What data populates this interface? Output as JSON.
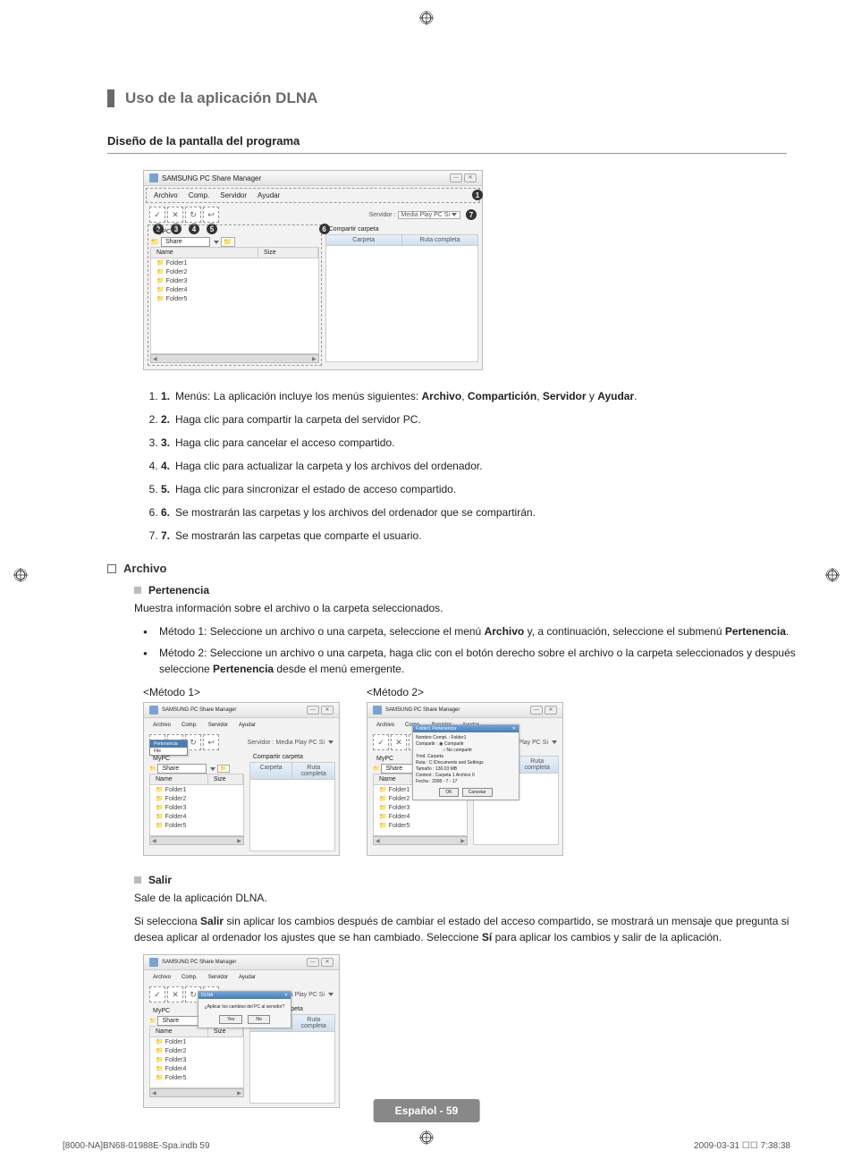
{
  "header": {
    "title": "Uso de la aplicación DLNA"
  },
  "section": {
    "subtitle": "Diseño de la pantalla del programa"
  },
  "app": {
    "title": "SAMSUNG PC Share Manager",
    "menus": [
      "Archivo",
      "Comp.",
      "Servidor",
      "Ayudar"
    ],
    "server_label": "Servidor :",
    "server_value": "Media Play PC Si",
    "mypc": "MyPC",
    "share_label": "Share",
    "compartir_carpeta": "Compartir carpeta",
    "columns": {
      "name": "Name",
      "size": "Size"
    },
    "right_columns": {
      "carpeta": "Carpeta",
      "ruta": "Ruta completa"
    },
    "folders": [
      "Folder1",
      "Folder2",
      "Folder3",
      "Folder4",
      "Folder5"
    ]
  },
  "steps": [
    {
      "n": "1.",
      "prefix": "Menús: La aplicación incluye los menús siguientes: ",
      "bold_list": [
        "Archivo",
        "Compartición",
        "Servidor",
        "Ayudar"
      ],
      "joiners": [
        ", ",
        ", ",
        " y ",
        "."
      ]
    },
    {
      "n": "2.",
      "text": "Haga clic para compartir la carpeta del servidor PC."
    },
    {
      "n": "3.",
      "text": "Haga clic para cancelar el acceso compartido."
    },
    {
      "n": "4.",
      "text": "Haga clic para actualizar la carpeta y los archivos del ordenador."
    },
    {
      "n": "5.",
      "text": "Haga clic para sincronizar el estado de acceso compartido."
    },
    {
      "n": "6.",
      "text": "Se mostrarán las carpetas y los archivos del ordenador que se compartirán."
    },
    {
      "n": "7.",
      "text": "Se mostrarán las carpetas que comparte el usuario."
    }
  ],
  "archivo": {
    "title": "Archivo",
    "pertenencia": {
      "title": "Pertenencia",
      "desc": "Muestra información sobre el archivo o la carpeta seleccionados.",
      "m1_pre": "Método 1: Seleccione un archivo o una carpeta, seleccione el menú ",
      "m1_bold1": "Archivo",
      "m1_mid": " y, a continuación, seleccione el submenú ",
      "m1_bold2": "Pertenencia",
      "m1_post": ".",
      "m2_pre": "Método 2: Seleccione un archivo o una carpeta, haga clic con el botón derecho sobre el archivo o la carpeta seleccionados y después seleccione ",
      "m2_bold": "Pertenencia",
      "m2_post": " desde el menú emergente.",
      "label1": "<Método 1>",
      "label2": "<Método 2>"
    },
    "salir": {
      "title": "Salir",
      "line1": "Sale de la aplicación DLNA.",
      "line2_pre": "Si selecciona ",
      "line2_b1": "Salir",
      "line2_mid": " sin aplicar los cambios después de cambiar el estado del acceso compartido, se mostrará un mensaje que pregunta si desea aplicar al ordenador los ajustes que se han cambiado. Seleccione ",
      "line2_b2": "Sí",
      "line2_post": " para aplicar los cambios y salir de la aplicación."
    }
  },
  "method_screens": {
    "dropdown": {
      "item1": "Pertenencia",
      "item2": "File"
    },
    "dialog": {
      "title": "Folder1 Pertenencia",
      "row1": "Nombre Compt. : Folder1",
      "row2_label": "Compartir :",
      "row2_a": "Compartir",
      "row2_b": "No compartir",
      "row3": "Ymd. Carpeta",
      "row4": "Ruta :    C:\\Documents and Settings",
      "row5": "Tamaño : 130.03 MB",
      "row6": "Content : Carpeta 1 Archivo 0",
      "row7": "Fecha : 2008 - 7 - 17",
      "ok": "OK",
      "cancel": "Cancelar"
    },
    "confirm": {
      "title": "DLNA",
      "msg": "¿Aplicar los cambios del PC al servidor?",
      "yes": "Yes",
      "no": "No"
    }
  },
  "footer": {
    "page": "Español - 59"
  },
  "print": {
    "left": "[8000-NA]BN68-01988E-Spa.indb   59",
    "right_date": "2009-03-31   ",
    "right_time": "7:38:38"
  }
}
